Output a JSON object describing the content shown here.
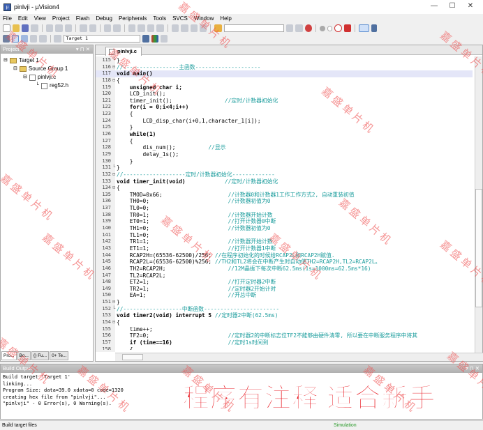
{
  "window": {
    "title": "pinlvji - µVision4",
    "minimize": "—",
    "maximize": "☐",
    "close": "✕"
  },
  "menu": [
    "File",
    "Edit",
    "View",
    "Project",
    "Flash",
    "Debug",
    "Peripherals",
    "Tools",
    "SVCS",
    "Window",
    "Help"
  ],
  "toolbar": {
    "target": "Target 1"
  },
  "project_panel": {
    "title": "Project",
    "tree": [
      "Target 1",
      "Source Group 1",
      "pinlvji.c",
      "reg52.h"
    ],
    "tabs": [
      "Pro...",
      "Bo...",
      "{} Fu...",
      "0+ Te..."
    ]
  },
  "editor": {
    "tab": "pinlvji.c",
    "lines": [
      {
        "n": "115",
        "f": "└",
        "c": "}",
        "m": ""
      },
      {
        "n": "116",
        "f": "⊟",
        "c": "",
        "m": "//-----------------主函数--------------------"
      },
      {
        "n": "117",
        "f": "",
        "c": "void main()",
        "m": "",
        "hl": true
      },
      {
        "n": "118",
        "f": "⊟",
        "c": "{",
        "m": ""
      },
      {
        "n": "119",
        "f": "",
        "c": "    unsigned char i;",
        "m": ""
      },
      {
        "n": "120",
        "f": "",
        "c": "    LCD_init();",
        "m": ""
      },
      {
        "n": "121",
        "f": "",
        "c": "    timer_init();                ",
        "m": "//定时/计数器初始化"
      },
      {
        "n": "122",
        "f": "",
        "c": "    for(i = 0;i<4;i++)",
        "m": ""
      },
      {
        "n": "123",
        "f": "",
        "c": "    {",
        "m": ""
      },
      {
        "n": "124",
        "f": "",
        "c": "        LCD_disp_char(i+0,1,character_1[i]);",
        "m": ""
      },
      {
        "n": "125",
        "f": "",
        "c": "    }",
        "m": ""
      },
      {
        "n": "126",
        "f": "",
        "c": "    while(1)",
        "m": ""
      },
      {
        "n": "127",
        "f": "",
        "c": "    {",
        "m": ""
      },
      {
        "n": "128",
        "f": "",
        "c": "        dis_num();          ",
        "m": "//显示"
      },
      {
        "n": "129",
        "f": "",
        "c": "        delay_1s();",
        "m": ""
      },
      {
        "n": "130",
        "f": "",
        "c": "    }",
        "m": ""
      },
      {
        "n": "131",
        "f": "└",
        "c": "}",
        "m": ""
      },
      {
        "n": "132",
        "f": "⊟",
        "c": "",
        "m": "//-------------------定时/计数器初始化-------------"
      },
      {
        "n": "133",
        "f": "",
        "c": "void timer_init(void)            ",
        "m": "//定时/计数器初始化"
      },
      {
        "n": "134",
        "f": "⊟",
        "c": "{",
        "m": ""
      },
      {
        "n": "135",
        "f": "",
        "c": "    TMOD=0x66;                    ",
        "m": "//计数器0和计数器1工作工作方式2, 自动重装初值"
      },
      {
        "n": "136",
        "f": "",
        "c": "    TH0=0;                        ",
        "m": "//计数器初值为0"
      },
      {
        "n": "137",
        "f": "",
        "c": "    TL0=0;",
        "m": ""
      },
      {
        "n": "138",
        "f": "",
        "c": "    TR0=1;                        ",
        "m": "//计数器开始计数"
      },
      {
        "n": "139",
        "f": "",
        "c": "    ET0=1;                        ",
        "m": "//打开计数器0中断"
      },
      {
        "n": "140",
        "f": "",
        "c": "    TH1=0;                        ",
        "m": "//计数器初值为0"
      },
      {
        "n": "141",
        "f": "",
        "c": "    TL1=0;",
        "m": ""
      },
      {
        "n": "142",
        "f": "",
        "c": "    TR1=1;                        ",
        "m": "//计数器开始计数"
      },
      {
        "n": "143",
        "f": "",
        "c": "    ET1=1;                        ",
        "m": "//打开计数器1中断"
      },
      {
        "n": "144",
        "f": "",
        "c": "    RCAP2H=(65536-62500)/256; ",
        "m": "//在程序初始化的时候给RCAP2L和RCAP2H赋值."
      },
      {
        "n": "145",
        "f": "",
        "c": "    RCAP2L=(65536-62500)%256; ",
        "m": "//TH2和TL2将会在中断产生时自动使TH2=RCAP2H,TL2=RCAP2L。"
      },
      {
        "n": "146",
        "f": "",
        "c": "    TH2=RCAP2H;                   ",
        "m": "//12M晶振下每次中断62.5ms(1s=1000ms=62.5ms*16)"
      },
      {
        "n": "147",
        "f": "",
        "c": "    TL2=RCAP2L;",
        "m": ""
      },
      {
        "n": "148",
        "f": "",
        "c": "    ET2=1;                        ",
        "m": "//打开定时器2中断"
      },
      {
        "n": "149",
        "f": "",
        "c": "    TR2=1;                        ",
        "m": "//定时器2开始计时"
      },
      {
        "n": "150",
        "f": "",
        "c": "    EA=1;                         ",
        "m": "//开总中断"
      },
      {
        "n": "151",
        "f": "⊟",
        "c": "}",
        "m": ""
      },
      {
        "n": "152",
        "f": "└",
        "c": "",
        "m": "//------------------中断函数-----------------------"
      },
      {
        "n": "153",
        "f": "",
        "c": "void timer2(void) interrupt 5 ",
        "m": "//定时器2中断(62.5ms)"
      },
      {
        "n": "154",
        "f": "⊟",
        "c": "{",
        "m": ""
      },
      {
        "n": "155",
        "f": "",
        "c": "    time++;",
        "m": ""
      },
      {
        "n": "156",
        "f": "",
        "c": "    TF2=0;                        ",
        "m": "//定时器2的中断标志位TF2不能够由硬件清零, 所以要在中断服务程序中将其"
      },
      {
        "n": "157",
        "f": "",
        "c": "    if (time==16)                 ",
        "m": "//定时1s时间到"
      },
      {
        "n": "158",
        "f": "",
        "c": "    {",
        "m": ""
      }
    ]
  },
  "build_output": {
    "title": "Build Output",
    "lines": [
      "Build target 'Target 1'",
      "linking...",
      "Program Size: data=39.0 xdata=0 code=1320",
      "creating hex file from \"pinlvji\"...",
      "\"pinlvji\" - 0 Error(s), 0 Warning(s)."
    ]
  },
  "banner": "程序有注释 适合新手",
  "watermark": "嘉盛单片机",
  "status": {
    "left": "Build target files",
    "mode": "Simulation"
  }
}
